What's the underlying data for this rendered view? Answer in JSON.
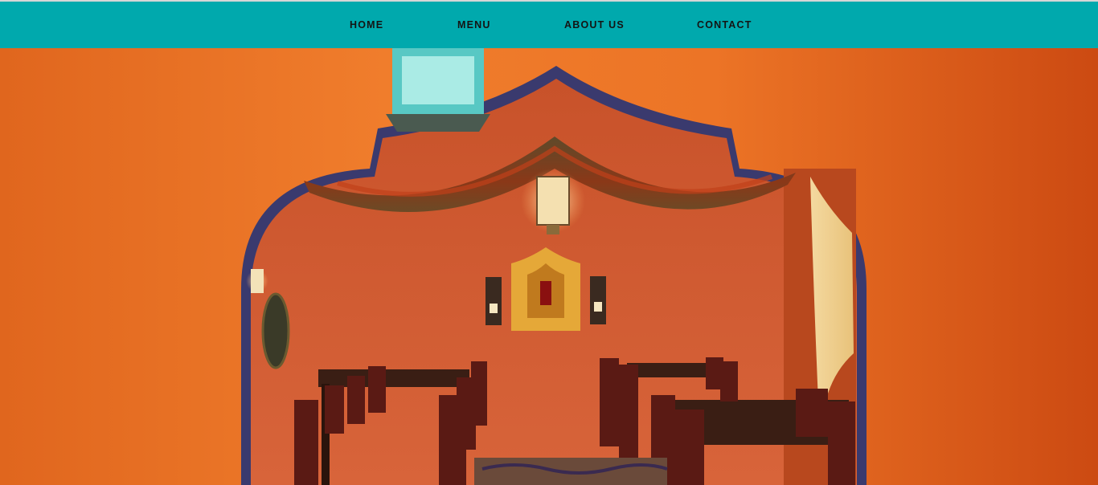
{
  "nav": {
    "items": [
      {
        "label": "HOME"
      },
      {
        "label": "MENU"
      },
      {
        "label": "ABOUT US"
      },
      {
        "label": "CONTACT"
      }
    ]
  },
  "hero": {
    "image": "restaurant-dining-room-photo",
    "colors": {
      "nav_background": "#00a9ad",
      "wall": "#e2661c",
      "arch_trim": "#3a3a6e"
    }
  }
}
